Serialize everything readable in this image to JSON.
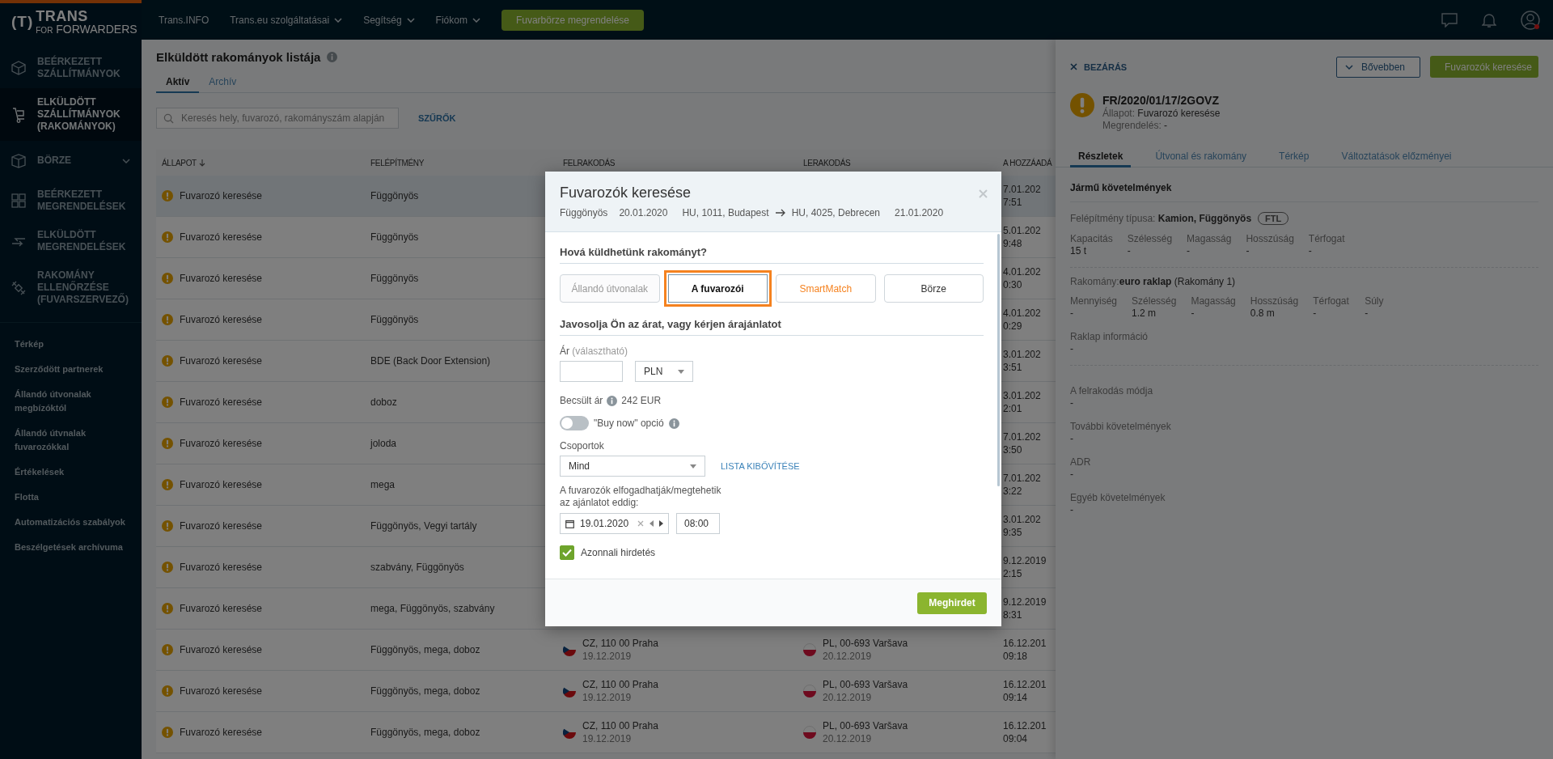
{
  "top_bar": {
    "logo": {
      "mark": "(T)",
      "name": "TRANS",
      "prefix": "FOR",
      "suffix": "FORWARDERS"
    },
    "nav": [
      {
        "label": "Trans.INFO",
        "dropdown": false
      },
      {
        "label": "Trans.eu szolgáltatásai",
        "dropdown": true
      },
      {
        "label": "Segítség",
        "dropdown": true
      },
      {
        "label": "Fiókom",
        "dropdown": true
      }
    ],
    "cta": "Fuvarbörze megrendelése",
    "account_alert": true
  },
  "sidebar": {
    "items": [
      {
        "label": "BEÉRKEZETT SZÁLLÍTMÁNYOK",
        "selected": false,
        "expandable": false
      },
      {
        "label": "ELKÜLDÖTT SZÁLLÍTMÁNYOK (RAKOMÁNYOK)",
        "selected": true,
        "expandable": false
      },
      {
        "label": "BÖRZE",
        "selected": false,
        "expandable": true
      },
      {
        "label": "BEÉRKEZETT MEGRENDELÉSEK",
        "selected": false,
        "expandable": false
      },
      {
        "label": "ELKÜLDÖTT MEGRENDELÉSEK",
        "selected": false,
        "expandable": false
      },
      {
        "label": "RAKOMÁNY ELLENŐRZÉSE (FUVARSZERVEZŐ)",
        "selected": false,
        "expandable": false
      }
    ],
    "links": [
      "Térkép",
      "Szerződött partnerek",
      "Állandó útvonalak megbízóktól",
      "Állandó útvnalak fuvarozókkal",
      "Értékelések",
      "Flotta",
      "Automatizációs szabályok",
      "Beszélgetések archívuma"
    ]
  },
  "page": {
    "title": "Elküldött rakományok listája",
    "tabs": [
      {
        "label": "Aktív",
        "selected": true
      },
      {
        "label": "Archív",
        "selected": false
      }
    ],
    "search": {
      "placeholder": "Keresés hely, fuvarozó, rakományszám alapján"
    },
    "filters": "SZŰRŐK"
  },
  "table": {
    "columns": [
      {
        "label": "ÁLLAPOT",
        "sorted": true
      },
      {
        "label": "FELÉPÍTMÉNY",
        "sorted": false
      },
      {
        "label": "FELRAKODÁS",
        "sorted": false
      },
      {
        "label": "LERAKODÁS",
        "sorted": false
      },
      {
        "label": "A HOZZÁADÁ",
        "sorted": false
      }
    ],
    "rows": [
      {
        "status": "Fuvarozó keresése",
        "body": "Függönyös",
        "added": [
          "7.01.202",
          "7:51"
        ],
        "selected": true
      },
      {
        "status": "Fuvarozó keresése",
        "body": "Függönyös",
        "added": [
          "5.01.202",
          "9:48"
        ],
        "selected": false
      },
      {
        "status": "Fuvarozó keresése",
        "body": "Függönyös",
        "added": [
          "4.01.202",
          "0:30"
        ],
        "selected": false
      },
      {
        "status": "Fuvarozó keresése",
        "body": "Függönyös",
        "added": [
          "4.01.202",
          "0:29"
        ],
        "selected": false
      },
      {
        "status": "Fuvarozó keresése",
        "body": "BDE (Back Door Extension)",
        "added": [
          "3.01.202",
          "3:51"
        ],
        "selected": false
      },
      {
        "status": "Fuvarozó keresése",
        "body": "doboz",
        "added": [
          "3.01.202",
          "2:01"
        ],
        "selected": false
      },
      {
        "status": "Fuvarozó keresése",
        "body": "joloda",
        "added": [
          "7.01.202",
          "3:50"
        ],
        "selected": false
      },
      {
        "status": "Fuvarozó keresése",
        "body": "mega",
        "added": [
          "7.01.202",
          "3:22"
        ],
        "selected": false
      },
      {
        "status": "Fuvarozó keresése",
        "body": "Függönyös, Vegyi tartály",
        "added": [
          "3.01.202",
          "9:35"
        ],
        "selected": false
      },
      {
        "status": "Fuvarozó keresése",
        "body": "szabvány, Függönyös",
        "added": [
          "9.12.2019",
          "2:15"
        ],
        "selected": false
      },
      {
        "status": "Fuvarozó keresése",
        "body": "mega, Függönyös, szabvány",
        "added": [
          "9.12.2019",
          "8:31"
        ],
        "selected": false
      },
      {
        "status": "Fuvarozó keresése",
        "body": "Függönyös, mega, doboz",
        "loading": {
          "kind": "cz",
          "place": "CZ, 110 00 Praha",
          "date": "19.12.2019"
        },
        "unloading": {
          "kind": "pl",
          "place": "PL, 00-693 Varšava",
          "date": "20.12.2019"
        },
        "added": [
          "16.12.201",
          "09:18"
        ],
        "selected": false
      },
      {
        "status": "Fuvarozó keresése",
        "body": "Függönyös, mega, doboz",
        "loading": {
          "kind": "cz",
          "place": "CZ, 110 00 Praha",
          "date": "19.12.2019"
        },
        "unloading": {
          "kind": "pl",
          "place": "PL, 00-693 Varšava",
          "date": "20.12.2019"
        },
        "added": [
          "16.12.201",
          "09:14"
        ],
        "selected": false
      },
      {
        "status": "Fuvarozó keresése",
        "body": "Függönyös, mega, doboz",
        "loading": {
          "kind": "cz",
          "place": "CZ, 110 00 Praha",
          "date": "19.12.2019"
        },
        "unloading": {
          "kind": "pl",
          "place": "PL, 00-693 Varšava",
          "date": "20.12.2019"
        },
        "added": [
          "16.12.201",
          "09:04"
        ],
        "selected": false
      }
    ]
  },
  "detail_panel": {
    "close": "BEZÁRÁS",
    "more": "Bővebben",
    "action": "Fuvarozók keresése",
    "id": "FR/2020/01/17/2GOVZ",
    "status": {
      "label": "Állapot:",
      "value": "Fuvarozó keresése"
    },
    "order": {
      "label": "Megrendelés:",
      "value": "-"
    },
    "tabs": [
      {
        "label": "Részletek",
        "selected": true
      },
      {
        "label": "Útvonal és rakomány",
        "selected": false
      },
      {
        "label": "Térkép",
        "selected": false
      },
      {
        "label": "Változtatások előzményei",
        "selected": false
      }
    ],
    "section": "Jármű követelmények",
    "body_type": {
      "label": "Felépítmény típusa:",
      "value": "Kamion, Függönyös",
      "badge": "FTL"
    },
    "vehicle_specs": [
      {
        "label": "Kapacitás",
        "value": "15 t"
      },
      {
        "label": "Szélesség",
        "value": "-"
      },
      {
        "label": "Magasság",
        "value": "-"
      },
      {
        "label": "Hosszúság",
        "value": "-"
      },
      {
        "label": "Térfogat",
        "value": "-"
      }
    ],
    "cargo": {
      "label": "Rakomány:",
      "value": "euro raklap",
      "note": "(Rakomány 1)"
    },
    "cargo_specs": [
      {
        "label": "Mennyiség",
        "value": "-"
      },
      {
        "label": "Szélesség",
        "value": "1.2 m"
      },
      {
        "label": "Magasság",
        "value": "-"
      },
      {
        "label": "Hosszúság",
        "value": "0.8 m"
      },
      {
        "label": "Térfogat",
        "value": "-"
      },
      {
        "label": "Súly",
        "value": "-"
      }
    ],
    "pallet_info": {
      "label": "Raklap információ",
      "value": "-"
    },
    "fields": [
      {
        "label": "A felrakodás módja",
        "value": "-"
      },
      {
        "label": "További követelmények",
        "value": "-"
      },
      {
        "label": "ADR",
        "value": "-"
      },
      {
        "label": "Egyéb követelmények",
        "value": "-"
      }
    ]
  },
  "modal": {
    "title": "Fuvarozók keresése",
    "summary": {
      "body": "Függönyös",
      "loading_date": "20.01.2020",
      "from": "HU, 1011, Budapest",
      "to": "HU, 4025, Debrecen",
      "unloading_date": "21.01.2020"
    },
    "target_heading": "Hová küldhetünk rakományt?",
    "targets": [
      {
        "label": "Állandó útvonalak",
        "selected": false,
        "disabled": true,
        "kind": "standard"
      },
      {
        "label": "A fuvarozói",
        "selected": true,
        "disabled": false,
        "kind": "standard"
      },
      {
        "label": "SmartMatch",
        "selected": false,
        "disabled": false,
        "kind": "smart"
      },
      {
        "label": "Börze",
        "selected": false,
        "disabled": false,
        "kind": "standard"
      }
    ],
    "price_heading": "Javosolja Ön az árat, vagy kérjen árajánlatot",
    "price": {
      "label": "Ár",
      "hint": "(választható)",
      "currency": "PLN"
    },
    "estimate": {
      "label": "Becsült ár",
      "value": "242 EUR"
    },
    "buy_now": {
      "label": "\"Buy now\" opció",
      "on": false
    },
    "groups": {
      "label": "Csoportok",
      "value": "Mind",
      "link": "LISTA KIBŐVÍTÉSE"
    },
    "deadline": {
      "label": "A fuvarozók elfogadhatják/megtehetik az ajánlatot eddig:",
      "date": "19.01.2020",
      "time": "08:00"
    },
    "instant": {
      "label": "Azonnali hirdetés",
      "checked": true
    },
    "submit": "Meghirdet"
  }
}
